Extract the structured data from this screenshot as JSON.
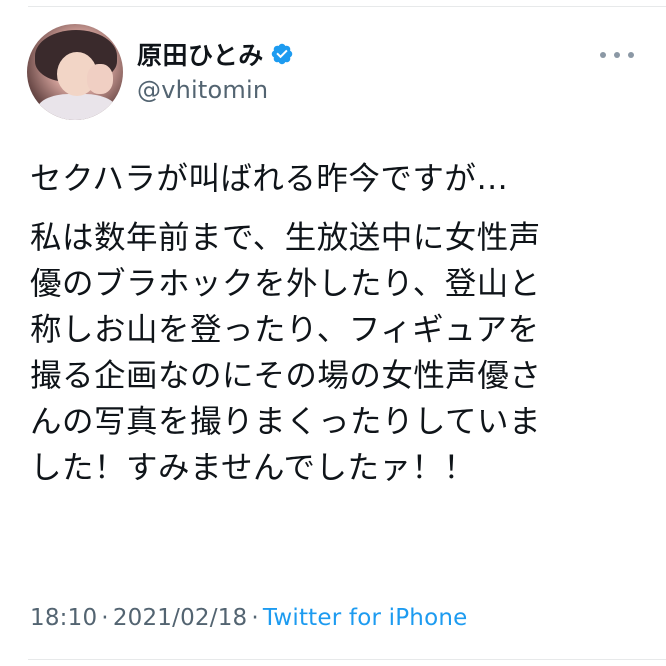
{
  "tweet": {
    "author": {
      "display_name": "原田ひとみ",
      "handle": "@vhitomin",
      "verified": true,
      "avatar_icon": "profile-photo"
    },
    "more_icon": "more-horizontal-icon",
    "text": {
      "paragraph_1": "セクハラが叫ばれる昨今ですが…",
      "paragraph_2": "私は数年前まで、生放送中に女性声\n優のブラホックを外したり、登山と\n称しお山を登ったり、フィギュアを\n撮る企画なのにその場の女性声優さ\nんの写真を撮りまくったりしていま\nした！すみませんでしたァ！！"
    },
    "meta": {
      "time": "18:10",
      "separator": "·",
      "date": "2021/02/18",
      "source": "Twitter for iPhone"
    }
  },
  "colors": {
    "text": "#0f1419",
    "secondary": "#536471",
    "link": "#1d9bf0",
    "verified_badge": "#1d9bf0",
    "divider": "#e7e9ea"
  }
}
